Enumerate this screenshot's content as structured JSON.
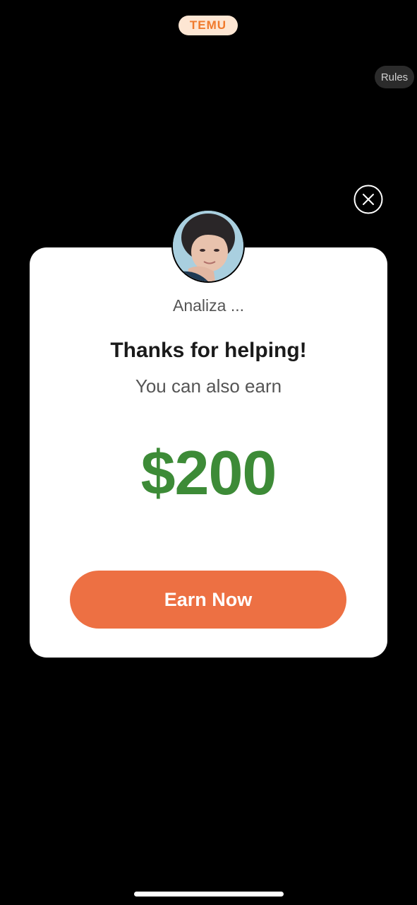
{
  "header": {
    "brand": "TEMU",
    "rules_label": "Rules"
  },
  "modal": {
    "user_name": "Analiza ...",
    "title": "Thanks for helping!",
    "subtitle": "You can also earn",
    "amount": "$200",
    "cta_label": "Earn Now"
  },
  "icons": {
    "close": "close-icon",
    "avatar": "avatar"
  },
  "colors": {
    "brand_orange": "#f07a2c",
    "cta_orange": "#ed7043",
    "amount_green": "#3d8b37",
    "background": "#000000"
  }
}
